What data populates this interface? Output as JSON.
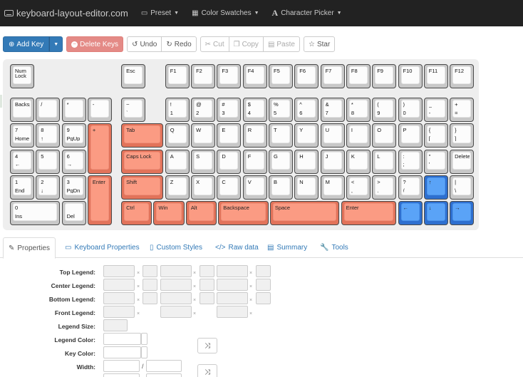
{
  "navbar": {
    "brand": "keyboard-layout-editor.com",
    "menus": [
      {
        "label": "Preset",
        "icon": "preset-icon"
      },
      {
        "label": "Color Swatches",
        "icon": "grid-icon"
      },
      {
        "label": "Character Picker",
        "icon": "letter-a-icon"
      }
    ]
  },
  "toolbar": {
    "add_keys": "Add Key",
    "delete_keys": "Delete Keys",
    "undo": "Undo",
    "redo": "Redo",
    "cut": "Cut",
    "copy": "Copy",
    "paste": "Paste",
    "star": "Star"
  },
  "colors": {
    "navbar_bg": "#222222",
    "primary": "#337ab7",
    "danger": "#e48a86",
    "key_orange": "#fb9b83",
    "key_blue": "#5aa3f7",
    "key_white": "#fcfcfc"
  },
  "keys": [
    {
      "id": "num-lock",
      "tl": "Num",
      "ml": "Lock",
      "bl": "",
      "c": "w"
    },
    {
      "id": "esc",
      "tl": "Esc",
      "bl": "",
      "c": "w"
    },
    {
      "id": "f1",
      "tl": "F1",
      "bl": "",
      "c": "w"
    },
    {
      "id": "f2",
      "tl": "F2",
      "bl": "",
      "c": "w"
    },
    {
      "id": "f3",
      "tl": "F3",
      "bl": "",
      "c": "w"
    },
    {
      "id": "f4",
      "tl": "F4",
      "bl": "",
      "c": "w"
    },
    {
      "id": "f5",
      "tl": "F5",
      "bl": "",
      "c": "w"
    },
    {
      "id": "f6",
      "tl": "F6",
      "bl": "",
      "c": "w"
    },
    {
      "id": "f7",
      "tl": "F7",
      "bl": "",
      "c": "w"
    },
    {
      "id": "f8",
      "tl": "F8",
      "bl": "",
      "c": "w"
    },
    {
      "id": "f9",
      "tl": "F9",
      "bl": "",
      "c": "w"
    },
    {
      "id": "f10",
      "tl": "F10",
      "bl": "",
      "c": "w"
    },
    {
      "id": "f11",
      "tl": "F11",
      "bl": "",
      "c": "w"
    },
    {
      "id": "f12",
      "tl": "F12",
      "bl": "",
      "c": "w"
    },
    {
      "id": "numpad-backspace",
      "tl": "Backspa",
      "bl": "",
      "c": "w"
    },
    {
      "id": "numpad-slash",
      "tl": "/",
      "bl": "",
      "c": "w"
    },
    {
      "id": "numpad-asterisk",
      "tl": "*",
      "bl": "",
      "c": "w"
    },
    {
      "id": "numpad-minus",
      "tl": "-",
      "bl": "",
      "c": "w"
    },
    {
      "id": "backtick",
      "tl": "~",
      "bl": "`",
      "c": "w"
    },
    {
      "id": "digit-1",
      "tl": "!",
      "bl": "1",
      "c": "w"
    },
    {
      "id": "digit-2",
      "tl": "@",
      "bl": "2",
      "c": "w"
    },
    {
      "id": "digit-3",
      "tl": "#",
      "bl": "3",
      "c": "w"
    },
    {
      "id": "digit-4",
      "tl": "$",
      "bl": "4",
      "c": "w"
    },
    {
      "id": "digit-5",
      "tl": "%",
      "bl": "5",
      "c": "w"
    },
    {
      "id": "digit-6",
      "tl": "^",
      "bl": "6",
      "c": "w"
    },
    {
      "id": "digit-7",
      "tl": "&",
      "bl": "7",
      "c": "w"
    },
    {
      "id": "digit-8",
      "tl": "*",
      "bl": "8",
      "c": "w"
    },
    {
      "id": "digit-9",
      "tl": "(",
      "bl": "9",
      "c": "w"
    },
    {
      "id": "digit-0",
      "tl": ")",
      "bl": "0",
      "c": "w"
    },
    {
      "id": "minus",
      "tl": "_",
      "bl": "-",
      "c": "w"
    },
    {
      "id": "equals",
      "tl": "+",
      "bl": "=",
      "c": "w"
    },
    {
      "id": "numpad-7",
      "tl": "7",
      "bl": "Home",
      "c": "w"
    },
    {
      "id": "numpad-8",
      "tl": "8",
      "bl": "↑",
      "c": "w"
    },
    {
      "id": "numpad-9",
      "tl": "9",
      "bl": "PgUp",
      "c": "w"
    },
    {
      "id": "numpad-plus",
      "tl": "+",
      "bl": "",
      "c": "o"
    },
    {
      "id": "tab",
      "tl": "Tab",
      "bl": "",
      "c": "o"
    },
    {
      "id": "q",
      "tl": "Q",
      "bl": "",
      "c": "w"
    },
    {
      "id": "w",
      "tl": "W",
      "bl": "",
      "c": "w"
    },
    {
      "id": "e",
      "tl": "E",
      "bl": "",
      "c": "w"
    },
    {
      "id": "r",
      "tl": "R",
      "bl": "",
      "c": "w"
    },
    {
      "id": "t",
      "tl": "T",
      "bl": "",
      "c": "w"
    },
    {
      "id": "y",
      "tl": "Y",
      "bl": "",
      "c": "w"
    },
    {
      "id": "u",
      "tl": "U",
      "bl": "",
      "c": "w"
    },
    {
      "id": "i",
      "tl": "I",
      "bl": "",
      "c": "w"
    },
    {
      "id": "o",
      "tl": "O",
      "bl": "",
      "c": "w"
    },
    {
      "id": "p",
      "tl": "P",
      "bl": "",
      "c": "w"
    },
    {
      "id": "left-bracket",
      "tl": "{",
      "bl": "[",
      "c": "w"
    },
    {
      "id": "right-bracket",
      "tl": "}",
      "bl": "]",
      "c": "w"
    },
    {
      "id": "numpad-4",
      "tl": "4",
      "bl": "←",
      "c": "w"
    },
    {
      "id": "numpad-5",
      "tl": "5",
      "bl": "",
      "c": "w"
    },
    {
      "id": "numpad-6",
      "tl": "6",
      "bl": "→",
      "c": "w"
    },
    {
      "id": "caps-lock",
      "tl": "Caps Lock",
      "bl": "",
      "c": "o"
    },
    {
      "id": "a",
      "tl": "A",
      "bl": "",
      "c": "w"
    },
    {
      "id": "s",
      "tl": "S",
      "bl": "",
      "c": "w"
    },
    {
      "id": "d",
      "tl": "D",
      "bl": "",
      "c": "w"
    },
    {
      "id": "f",
      "tl": "F",
      "bl": "",
      "c": "w"
    },
    {
      "id": "g",
      "tl": "G",
      "bl": "",
      "c": "w"
    },
    {
      "id": "h",
      "tl": "H",
      "bl": "",
      "c": "w"
    },
    {
      "id": "j",
      "tl": "J",
      "bl": "",
      "c": "w"
    },
    {
      "id": "k",
      "tl": "K",
      "bl": "",
      "c": "w"
    },
    {
      "id": "l",
      "tl": "L",
      "bl": "",
      "c": "w"
    },
    {
      "id": "semicolon",
      "tl": ":",
      "bl": ";",
      "c": "w"
    },
    {
      "id": "quote",
      "tl": "\"",
      "bl": "'",
      "c": "w"
    },
    {
      "id": "delete",
      "tl": "Delete",
      "bl": "",
      "c": "w"
    },
    {
      "id": "numpad-1",
      "tl": "1",
      "bl": "End",
      "c": "w"
    },
    {
      "id": "numpad-2",
      "tl": "2",
      "bl": "↓",
      "c": "w"
    },
    {
      "id": "numpad-3",
      "tl": "3",
      "bl": "PgDn",
      "c": "w"
    },
    {
      "id": "numpad-enter",
      "tl": "Enter",
      "bl": "",
      "c": "o"
    },
    {
      "id": "shift",
      "tl": "Shift",
      "bl": "",
      "c": "o"
    },
    {
      "id": "z",
      "tl": "Z",
      "bl": "",
      "c": "w"
    },
    {
      "id": "x",
      "tl": "X",
      "bl": "",
      "c": "w"
    },
    {
      "id": "c",
      "tl": "C",
      "bl": "",
      "c": "w"
    },
    {
      "id": "v",
      "tl": "V",
      "bl": "",
      "c": "w"
    },
    {
      "id": "b",
      "tl": "B",
      "bl": "",
      "c": "w"
    },
    {
      "id": "n",
      "tl": "N",
      "bl": "",
      "c": "w"
    },
    {
      "id": "m",
      "tl": "M",
      "bl": "",
      "c": "w"
    },
    {
      "id": "comma",
      "tl": "<",
      "bl": ",",
      "c": "w"
    },
    {
      "id": "period",
      "tl": ">",
      "bl": ".",
      "c": "w"
    },
    {
      "id": "slash",
      "tl": "?",
      "bl": "/",
      "c": "w"
    },
    {
      "id": "arrow-up",
      "tl": "↑",
      "bl": "",
      "c": "b"
    },
    {
      "id": "backslash",
      "tl": "|",
      "bl": "\\",
      "c": "w"
    },
    {
      "id": "numpad-0",
      "tl": "0",
      "bl": "Ins",
      "c": "w"
    },
    {
      "id": "numpad-del",
      "tl": "",
      "bl": "Del",
      "c": "w"
    },
    {
      "id": "ctrl",
      "tl": "Ctrl",
      "bl": "",
      "c": "o"
    },
    {
      "id": "win",
      "tl": "Win",
      "bl": "",
      "c": "o"
    },
    {
      "id": "alt",
      "tl": "Alt",
      "bl": "",
      "c": "o"
    },
    {
      "id": "backspace",
      "tl": "Backspace",
      "bl": "",
      "c": "o"
    },
    {
      "id": "space",
      "tl": "Space",
      "bl": "",
      "c": "o"
    },
    {
      "id": "enter",
      "tl": "Enter",
      "bl": "",
      "c": "o"
    },
    {
      "id": "arrow-left",
      "tl": "←",
      "bl": "",
      "c": "b"
    },
    {
      "id": "arrow-down",
      "tl": "↓",
      "bl": "",
      "c": "b"
    },
    {
      "id": "arrow-right",
      "tl": "→",
      "bl": "",
      "c": "b"
    }
  ],
  "tabs": [
    {
      "label": "Properties",
      "icon": "edit-icon",
      "active": true
    },
    {
      "label": "Keyboard Properties",
      "icon": "keyboard-icon",
      "active": false
    },
    {
      "label": "Custom Styles",
      "icon": "file-icon",
      "active": false
    },
    {
      "label": "Raw data",
      "icon": "code-icon",
      "active": false
    },
    {
      "label": "Summary",
      "icon": "document-icon",
      "active": false
    },
    {
      "label": "Tools",
      "icon": "wrench-icon",
      "active": false
    }
  ],
  "properties": {
    "top_legend": "Top Legend:",
    "center_legend": "Center Legend:",
    "bottom_legend": "Bottom Legend:",
    "front_legend": "Front Legend:",
    "legend_size": "Legend Size:",
    "legend_color": "Legend Color:",
    "key_color": "Key Color:",
    "width": "Width:",
    "clear_glyph": "×",
    "slash": "/",
    "shuffle_glyph": "⤨"
  }
}
